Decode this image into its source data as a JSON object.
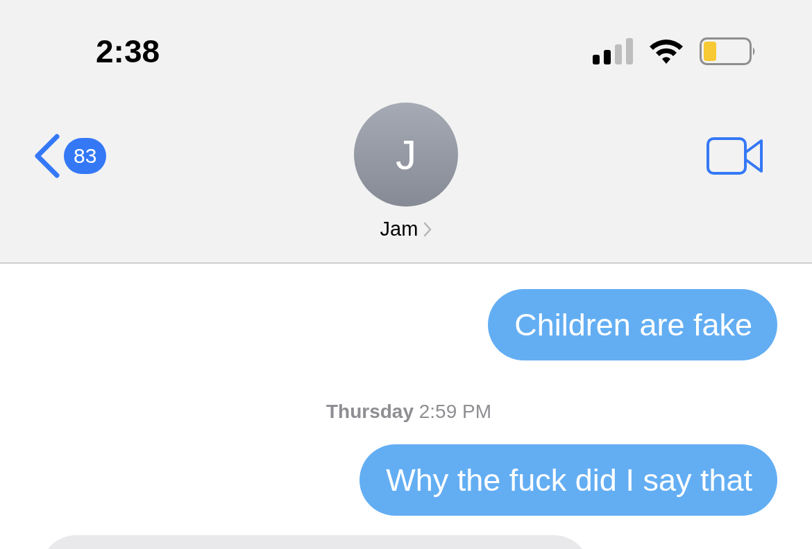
{
  "status_bar": {
    "time": "2:38"
  },
  "header": {
    "back_badge": "83",
    "avatar_initial": "J",
    "contact_name": "Jam"
  },
  "messages": [
    {
      "kind": "outgoing",
      "text": "Children are fake"
    },
    {
      "kind": "timestamp",
      "text": "**Thursday** 2:59 PM"
    },
    {
      "kind": "outgoing",
      "text": "Why the fuck did I say that"
    },
    {
      "kind": "incoming"
    }
  ]
}
